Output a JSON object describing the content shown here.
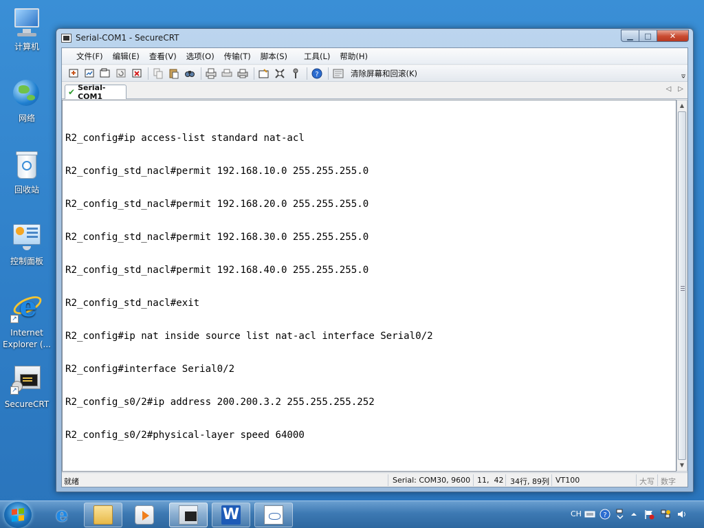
{
  "desktop": {
    "icons": [
      {
        "label": "计算机",
        "icon": "computer-icon"
      },
      {
        "label": "网络",
        "icon": "network-icon"
      },
      {
        "label": "回收站",
        "icon": "recycle-bin-icon"
      },
      {
        "label": "控制面板",
        "icon": "control-panel-icon"
      },
      {
        "label": "Internet Explorer (...",
        "icon": "internet-explorer-icon"
      },
      {
        "label": "SecureCRT",
        "icon": "securecrt-icon"
      }
    ]
  },
  "window": {
    "title": "Serial-COM1 - SecureCRT",
    "menu": [
      "文件(F)",
      "编辑(E)",
      "查看(V)",
      "选项(O)",
      "传输(T)",
      "脚本(S)",
      "工具(L)",
      "帮助(H)"
    ],
    "toolbar": {
      "clear_label": "清除屏幕和回滚(K)",
      "icons": [
        "connect-icon",
        "quick-connect-icon",
        "connect-tab-icon",
        "reconnect-icon",
        "disconnect-icon",
        "copy-icon",
        "paste-icon",
        "find-icon",
        "print-setup-icon",
        "print-selection-icon",
        "print-icon",
        "session-options-icon",
        "global-options-icon",
        "keymap-icon",
        "help-icon",
        "clear-screen-icon"
      ]
    },
    "tab": {
      "label": "Serial-COM1"
    },
    "terminal": {
      "lines": [
        "R2_config#ip access-list standard nat-acl",
        "R2_config_std_nacl#permit 192.168.10.0 255.255.255.0",
        "R2_config_std_nacl#permit 192.168.20.0 255.255.255.0",
        "R2_config_std_nacl#permit 192.168.30.0 255.255.255.0",
        "R2_config_std_nacl#permit 192.168.40.0 255.255.255.0",
        "R2_config_std_nacl#exit",
        "R2_config#ip nat inside source list nat-acl interface Serial0/2",
        "R2_config#interface Serial0/2",
        "R2_config_s0/2#ip address 200.200.3.2 255.255.255.252",
        "R2_config_s0/2#physical-layer speed 64000"
      ]
    },
    "status": {
      "ready": "就绪",
      "connection": "Serial: COM30, 9600",
      "cursor": "11,  42",
      "size": "34行, 89列",
      "emulation": "VT100",
      "caps": "大写",
      "num": "数字"
    }
  },
  "taskbar": {
    "apps": [
      "internet-explorer-icon",
      "explorer-folder-icon",
      "media-player-icon",
      "securecrt-icon",
      "wps-writer-icon",
      "document-icon"
    ],
    "tray": {
      "ime": "CH"
    }
  }
}
